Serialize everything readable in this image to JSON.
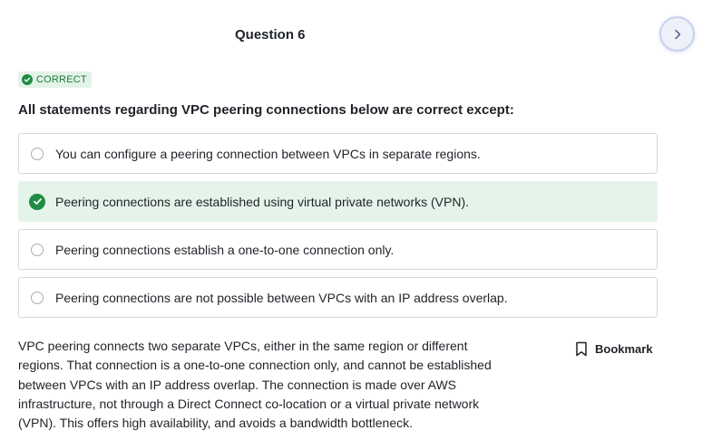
{
  "question": {
    "title": "Question 6"
  },
  "navigation": {
    "next_icon": "chevron-right-icon"
  },
  "status": {
    "label": "CORRECT",
    "color": "#1e8c45"
  },
  "prompt": "All statements regarding VPC peering connections below are correct except:",
  "options": [
    {
      "label": "You can configure a peering connection between VPCs in separate regions.",
      "selected": false
    },
    {
      "label": "Peering connections are established using virtual private networks (VPN).",
      "selected": true
    },
    {
      "label": "Peering connections establish a one-to-one connection only.",
      "selected": false
    },
    {
      "label": "Peering connections are not possible between VPCs with an IP address overlap.",
      "selected": false
    }
  ],
  "explanation": "VPC peering connects two separate VPCs, either in the same region or different regions. That connection is a one-to-one connection only, and cannot be established between VPCs with an IP address overlap. The connection is made over AWS infrastructure, not through a Direct Connect co-location or a virtual private network (VPN). This offers high availability, and avoids a bandwidth bottleneck.",
  "bookmark": {
    "label": "Bookmark",
    "icon": "bookmark-icon"
  }
}
